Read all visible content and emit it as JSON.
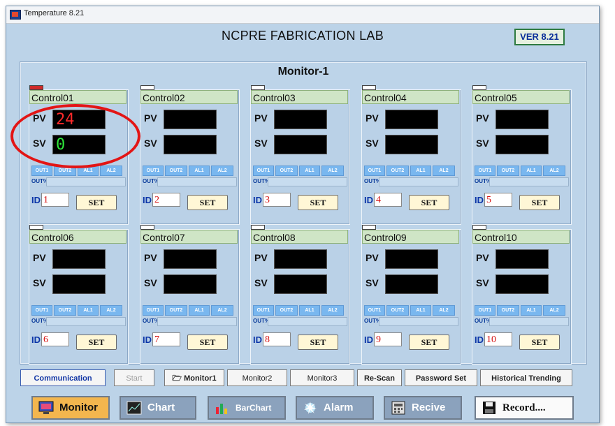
{
  "window": {
    "title": "Temperature 8.21"
  },
  "header": {
    "lab_title": "NCPRE FABRICATION LAB",
    "version": "VER 8.21"
  },
  "monitor": {
    "title": "Monitor-1"
  },
  "labels": {
    "pv": "PV",
    "sv": "SV",
    "out1": "OUT1",
    "out2": "OUT2",
    "al1": "AL1",
    "al2": "AL2",
    "outpct": "OUT%",
    "id": "ID",
    "set": "SET"
  },
  "controllers": [
    {
      "name": "Control01",
      "pv": "24",
      "sv": "0",
      "id": "1",
      "active": true
    },
    {
      "name": "Control02",
      "pv": "",
      "sv": "",
      "id": "2",
      "active": false
    },
    {
      "name": "Control03",
      "pv": "",
      "sv": "",
      "id": "3",
      "active": false
    },
    {
      "name": "Control04",
      "pv": "",
      "sv": "",
      "id": "4",
      "active": false
    },
    {
      "name": "Control05",
      "pv": "",
      "sv": "",
      "id": "5",
      "active": false
    },
    {
      "name": "Control06",
      "pv": "",
      "sv": "",
      "id": "6",
      "active": false
    },
    {
      "name": "Control07",
      "pv": "",
      "sv": "",
      "id": "7",
      "active": false
    },
    {
      "name": "Control08",
      "pv": "",
      "sv": "",
      "id": "8",
      "active": false
    },
    {
      "name": "Control09",
      "pv": "",
      "sv": "",
      "id": "9",
      "active": false
    },
    {
      "name": "Control10",
      "pv": "",
      "sv": "",
      "id": "10",
      "active": false
    }
  ],
  "controls": {
    "communication": "Communication",
    "start": "Start",
    "monitor1": "Monitor1",
    "monitor2": "Monitor2",
    "monitor3": "Monitor3",
    "rescan": "Re-Scan",
    "password": "Password Set",
    "historical": "Historical Trending"
  },
  "nav": {
    "monitor": "Monitor",
    "chart": "Chart",
    "barchart": "BarChart",
    "alarm": "Alarm",
    "recive": "Recive",
    "record": "Record...."
  },
  "colors": {
    "pv_digit": "#ff2a2a",
    "sv_digit": "#2ee63a",
    "annotation": "#e31515",
    "panel": "#bcd3e8"
  }
}
